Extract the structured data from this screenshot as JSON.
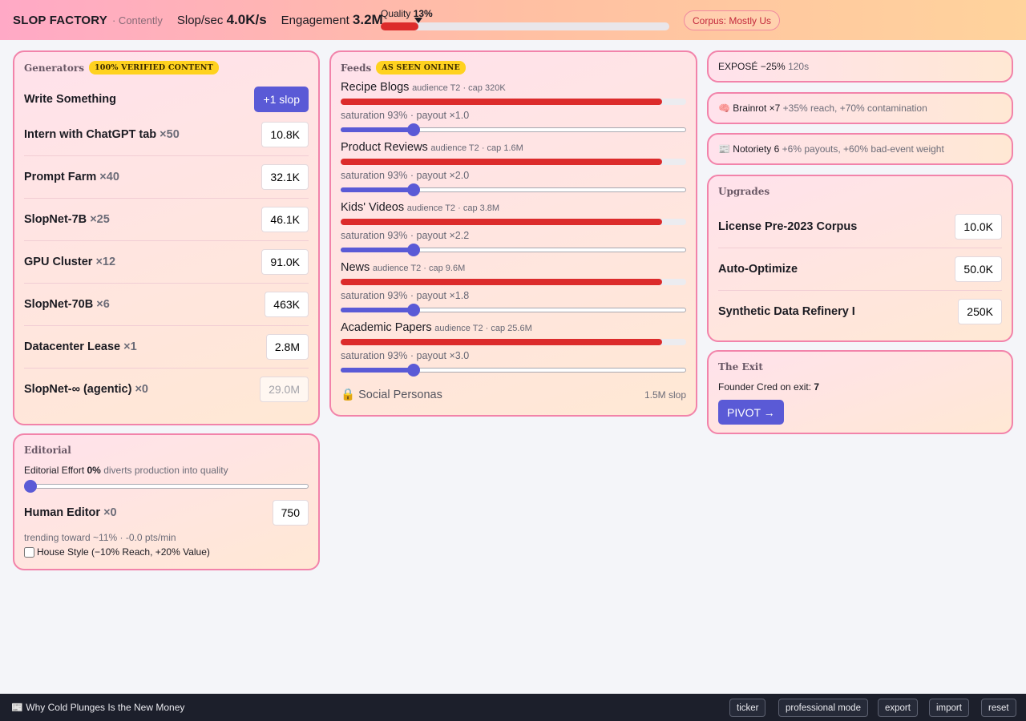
{
  "header": {
    "brand": "SLOP FACTORY",
    "brand_sub": "· Contently",
    "slop_label": "Slop/sec",
    "slop_value": "4.0K/s",
    "engagement_label": "Engagement",
    "engagement_value": "3.2M",
    "quality_label": "Quality",
    "quality_value": "13%",
    "quality_fraction": 0.13,
    "corpus": "Corpus: Mostly Us"
  },
  "generators": {
    "title": "Generators",
    "tag": "100% VERIFIED CONTENT",
    "write_label": "Write Something",
    "write_button": "+1 slop",
    "items": [
      {
        "name": "Intern with ChatGPT tab",
        "count": "×50",
        "cost": "10.8K"
      },
      {
        "name": "Prompt Farm",
        "count": "×40",
        "cost": "32.1K"
      },
      {
        "name": "SlopNet-7B",
        "count": "×25",
        "cost": "46.1K"
      },
      {
        "name": "GPU Cluster",
        "count": "×12",
        "cost": "91.0K"
      },
      {
        "name": "SlopNet-70B",
        "count": "×6",
        "cost": "463K"
      },
      {
        "name": "Datacenter Lease",
        "count": "×1",
        "cost": "2.8M"
      },
      {
        "name": "SlopNet-∞ (agentic)",
        "count": "×0",
        "cost": "29.0M"
      }
    ]
  },
  "editorial": {
    "title": "Editorial",
    "effort_label": "Editorial Effort",
    "effort_value": "0%",
    "effort_desc": "diverts production into quality",
    "effort_fraction": 0.0,
    "editor_name": "Human Editor",
    "editor_count": "×0",
    "editor_cost": "750",
    "trend": "trending toward ~11% · -0.0 pts/min",
    "house_style": "House Style (−10% Reach, +20% Value)"
  },
  "feeds": {
    "title": "Feeds",
    "tag": "AS SEEN ONLINE",
    "items": [
      {
        "name": "Recipe Blogs",
        "meta": "audience T2 · cap 320K",
        "info": "saturation 93% · payout ×1.0",
        "saturation": 0.93,
        "slider": 0.21
      },
      {
        "name": "Product Reviews",
        "meta": "audience T2 · cap 1.6M",
        "info": "saturation 93% · payout ×2.0",
        "saturation": 0.93,
        "slider": 0.21
      },
      {
        "name": "Kids' Videos",
        "meta": "audience T2 · cap 3.8M",
        "info": "saturation 93% · payout ×2.2",
        "saturation": 0.93,
        "slider": 0.21
      },
      {
        "name": "News",
        "meta": "audience T2 · cap 9.6M",
        "info": "saturation 93% · payout ×1.8",
        "saturation": 0.93,
        "slider": 0.21
      },
      {
        "name": "Academic Papers",
        "meta": "audience T2 · cap 25.6M",
        "info": "saturation 93% · payout ×3.0",
        "saturation": 0.93,
        "slider": 0.21
      }
    ],
    "locked_name": "🔒 Social Personas",
    "locked_cost": "1.5M slop"
  },
  "status": {
    "expose_label": "EXPOSÉ −25%",
    "expose_timer": "120s",
    "brainrot_label": "🧠 Brainrot ×7",
    "brainrot_desc": "+35% reach, +70% contamination",
    "notoriety_label": "📰 Notoriety 6",
    "notoriety_desc": "+6% payouts, +60% bad-event weight"
  },
  "upgrades": {
    "title": "Upgrades",
    "items": [
      {
        "name": "License Pre-2023 Corpus",
        "cost": "10.0K"
      },
      {
        "name": "Auto-Optimize",
        "cost": "50.0K"
      },
      {
        "name": "Synthetic Data Refinery I",
        "cost": "250K"
      }
    ]
  },
  "exit": {
    "title": "The Exit",
    "cred_label": "Founder Cred on exit:",
    "cred_value": "7",
    "pivot_button": "PIVOT →"
  },
  "footer": {
    "headline": "📰 Why Cold Plunges Is the New Money",
    "ticker": "ticker",
    "professional": "professional mode",
    "export": "export",
    "import": "import",
    "reset": "reset"
  },
  "colors": {
    "accent": "#5a5ad6",
    "danger": "#dc2b2b",
    "panel_border": "#f283aa",
    "tag": "#ffd21f"
  }
}
